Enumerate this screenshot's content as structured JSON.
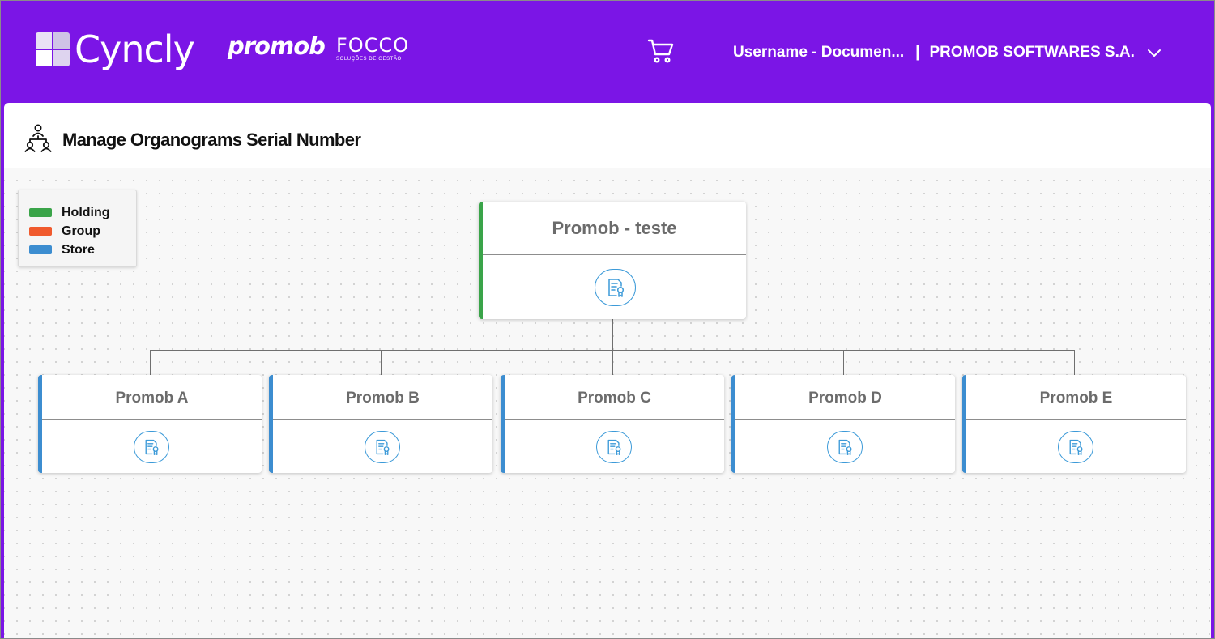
{
  "header": {
    "brands": {
      "cyncly": "Cyncly",
      "promob": "promob",
      "focco": "FOCCO",
      "focco_tagline": "SOLUÇÕES DE GESTÃO"
    },
    "user_label": "Username - Documen...",
    "separator": "|",
    "company_label": "PROMOB SOFTWARES S.A.",
    "icons": {
      "cart": "cart-icon",
      "dropdown": "chevron-down-icon"
    }
  },
  "page": {
    "title": "Manage Organograms Serial Number",
    "icon": "organogram-icon"
  },
  "legend": [
    {
      "label": "Holding",
      "color": "#3aa449"
    },
    {
      "label": "Group",
      "color": "#f05a2d"
    },
    {
      "label": "Store",
      "color": "#3c8dd0"
    }
  ],
  "org": {
    "root": {
      "name": "Promob - teste",
      "type": "Holding"
    },
    "children": [
      {
        "name": "Promob A",
        "type": "Store"
      },
      {
        "name": "Promob B",
        "type": "Store"
      },
      {
        "name": "Promob C",
        "type": "Store"
      },
      {
        "name": "Promob D",
        "type": "Store"
      },
      {
        "name": "Promob E",
        "type": "Store"
      }
    ],
    "node_action_icon": "certificate-document-icon"
  },
  "colors": {
    "header_bg": "#7b15e6",
    "holding": "#3aa449",
    "group": "#f05a2d",
    "store": "#3c8dd0",
    "accent_icon": "#3c9ad8"
  }
}
